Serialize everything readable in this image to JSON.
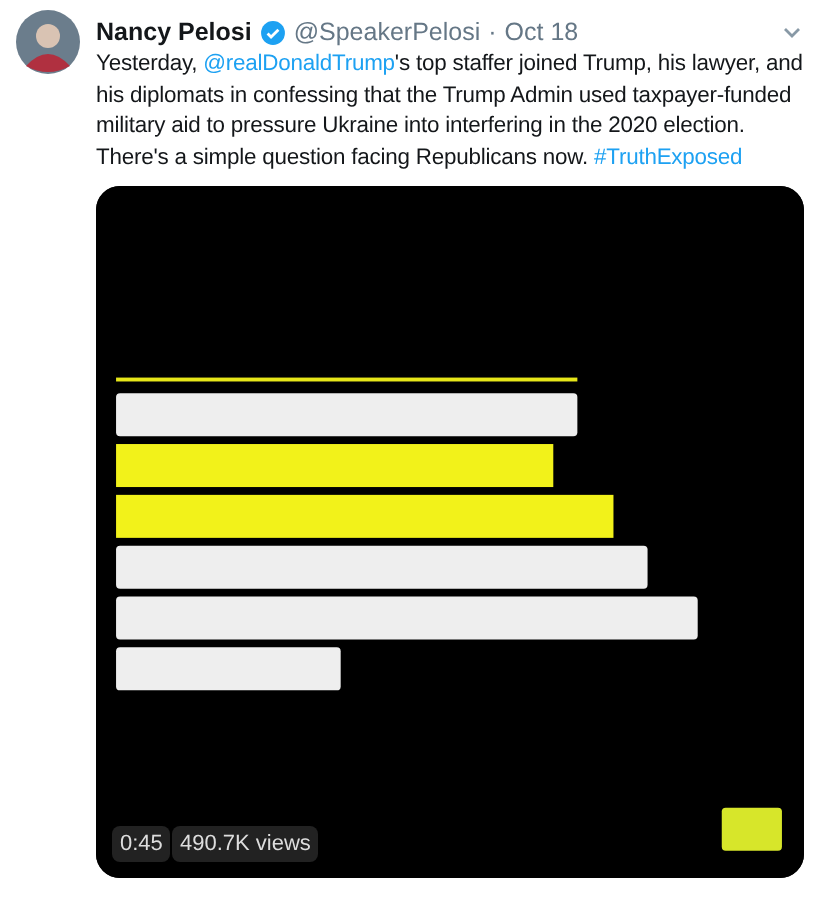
{
  "tweet": {
    "author_name": "Nancy Pelosi",
    "verified": true,
    "handle": "@SpeakerPelosi",
    "separator": "·",
    "date": "Oct 18",
    "text": [
      {
        "kind": "plain",
        "text": "Yesterday, "
      },
      {
        "kind": "link",
        "text": "@realDonaldTrump"
      },
      {
        "kind": "plain",
        "text": "'s top staffer joined Trump, his lawyer, and his diplomats in confessing that the Trump Admin used taxpayer-funded military aid to pressure Ukraine into interfering in the 2020 election. There's a simple question facing Republicans now. "
      },
      {
        "kind": "link",
        "text": "#TruthExposed"
      }
    ],
    "video": {
      "kind": "picture",
      "duration": "0:45",
      "views": "490.7K views"
    }
  }
}
